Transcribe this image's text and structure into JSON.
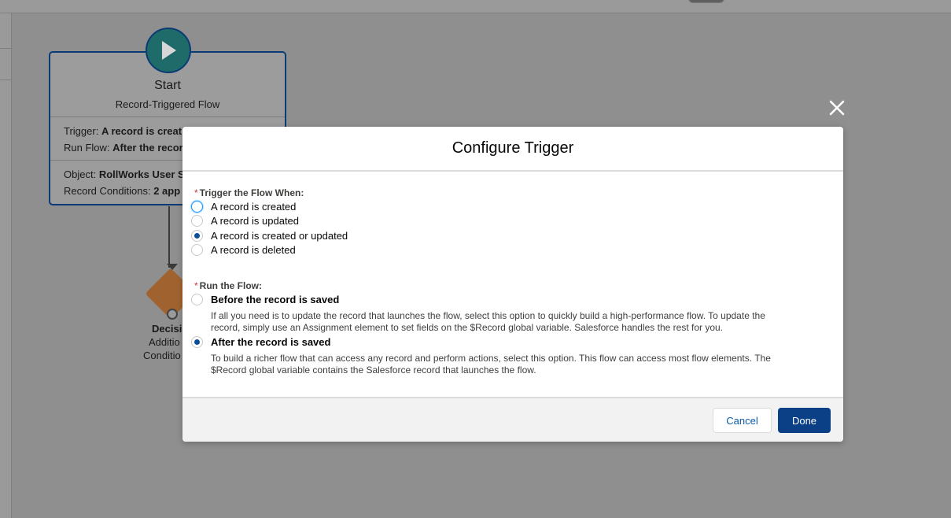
{
  "canvas": {
    "start_node": {
      "title": "Start",
      "subtitle": "Record-Triggered Flow",
      "trigger_label": "Trigger:",
      "trigger_value": "A record is creat",
      "run_flow_label": "Run Flow:",
      "run_flow_value": "After the recor",
      "object_label": "Object:",
      "object_value": "RollWorks User S",
      "conditions_label": "Record Conditions:",
      "conditions_value": "2 app"
    },
    "decision_node": {
      "title": "Decisi",
      "line1": "Additio",
      "line2": "Conditio"
    }
  },
  "modal": {
    "title": "Configure Trigger",
    "trigger_group": {
      "required_mark": "*",
      "label": "Trigger the Flow When:",
      "options": [
        {
          "label": "A record is created",
          "checked": false,
          "focused": true
        },
        {
          "label": "A record is updated",
          "checked": false
        },
        {
          "label": "A record is created or updated",
          "checked": true
        },
        {
          "label": "A record is deleted",
          "checked": false
        }
      ]
    },
    "run_group": {
      "required_mark": "*",
      "label": "Run the Flow:",
      "options": [
        {
          "label": "Before the record is saved",
          "checked": false,
          "help_line1": "If all you need is to update the record that launches the flow, select this option to quickly build a high-performance flow. To update the",
          "help_line2": "record, simply use an Assignment element to set fields on the $Record global variable. Salesforce handles the rest for you."
        },
        {
          "label": "After the record is saved",
          "checked": true,
          "help_line1": "To build a richer flow that can access any record and perform actions, select this option. This flow can access most flow elements. The",
          "help_line2": "$Record global variable contains the Salesforce record that launches the flow."
        }
      ]
    },
    "footer": {
      "cancel_label": "Cancel",
      "done_label": "Done"
    }
  },
  "colors": {
    "primary_button": "#0b3f86",
    "radio_checked": "#0b4f9a",
    "focus_ring": "#1b96ff",
    "required": "#c23934"
  }
}
